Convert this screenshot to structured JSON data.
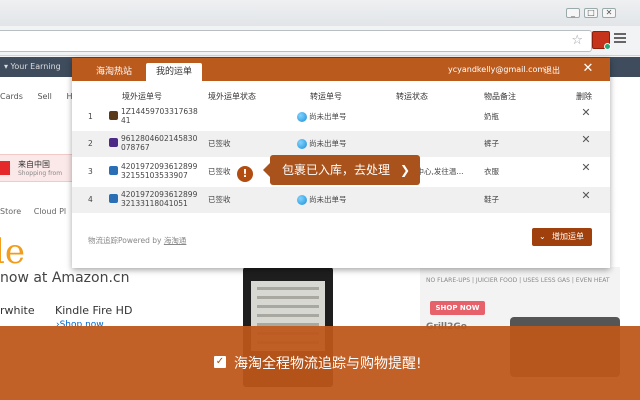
{
  "browser": {
    "window_min": "_",
    "window_max": "□",
    "window_close": "✕",
    "star_icon": "☆"
  },
  "background_page": {
    "nav_text": "▾  Your Earning",
    "links": [
      "Cards",
      "Sell",
      "He"
    ],
    "cn_banner_line1": "来自中国",
    "cn_banner_line2": "Shopping from",
    "store_links": [
      "Store",
      "Cloud Pl"
    ],
    "big_text": "le",
    "amazon_text": "now at Amazon.cn",
    "kindle_left": "rwhite",
    "kindle_right": "Kindle Fire HD",
    "shop_now_link": "›Shop now",
    "ad_tagline": "NO FLARE-UPS | JUICIER FOOD | USES LESS GAS | EVEN HEAT",
    "ad_button": "SHOP NOW",
    "ad_brand": "Grill2Go"
  },
  "popup": {
    "tabs": [
      "海淘热站",
      "我的运单"
    ],
    "email": "ycyandkelly@gmail.com",
    "logout": "退出",
    "close": "✕",
    "columns": [
      "境外运单号",
      "境外运单状态",
      "转运单号",
      "转运状态",
      "物品备注",
      "删除"
    ],
    "rows": [
      {
        "num": "1",
        "carrier_color": "#5a3a1a",
        "tracking": "1Z1445970331763841",
        "status": "",
        "transfer": "尚未出单号",
        "transfer_status": "",
        "note": "奶瓶",
        "delete": "✕"
      },
      {
        "num": "2",
        "carrier_color": "#4d2a86",
        "tracking": "9612804602145830078767",
        "status": "已签收",
        "transfer": "尚未出单号",
        "transfer_status": "",
        "note": "裤子",
        "delete": "✕"
      },
      {
        "num": "3",
        "carrier_color": "#2a6fb5",
        "tracking": "420197209361289932155103533907",
        "status": "已签收",
        "transfer": "",
        "transfer_status": "理中心,发往温...",
        "note": "衣服",
        "delete": "✕"
      },
      {
        "num": "4",
        "carrier_color": "#2a6fb5",
        "tracking": "420197209361289932133118041051",
        "status": "已签收",
        "transfer": "尚未出单号",
        "transfer_status": "",
        "note": "鞋子",
        "delete": "✕"
      }
    ],
    "powered_prefix": "物流追踪Powered by ",
    "powered_link": "海淘通",
    "add_button": "增加运单",
    "add_chevron": "⌄"
  },
  "tooltip": {
    "warn_glyph": "!",
    "text": "包裹已入库，去处理",
    "arrow": "❯"
  },
  "banner": {
    "check": "✓",
    "text": "海淘全程物流追踪与购物提醒!"
  }
}
